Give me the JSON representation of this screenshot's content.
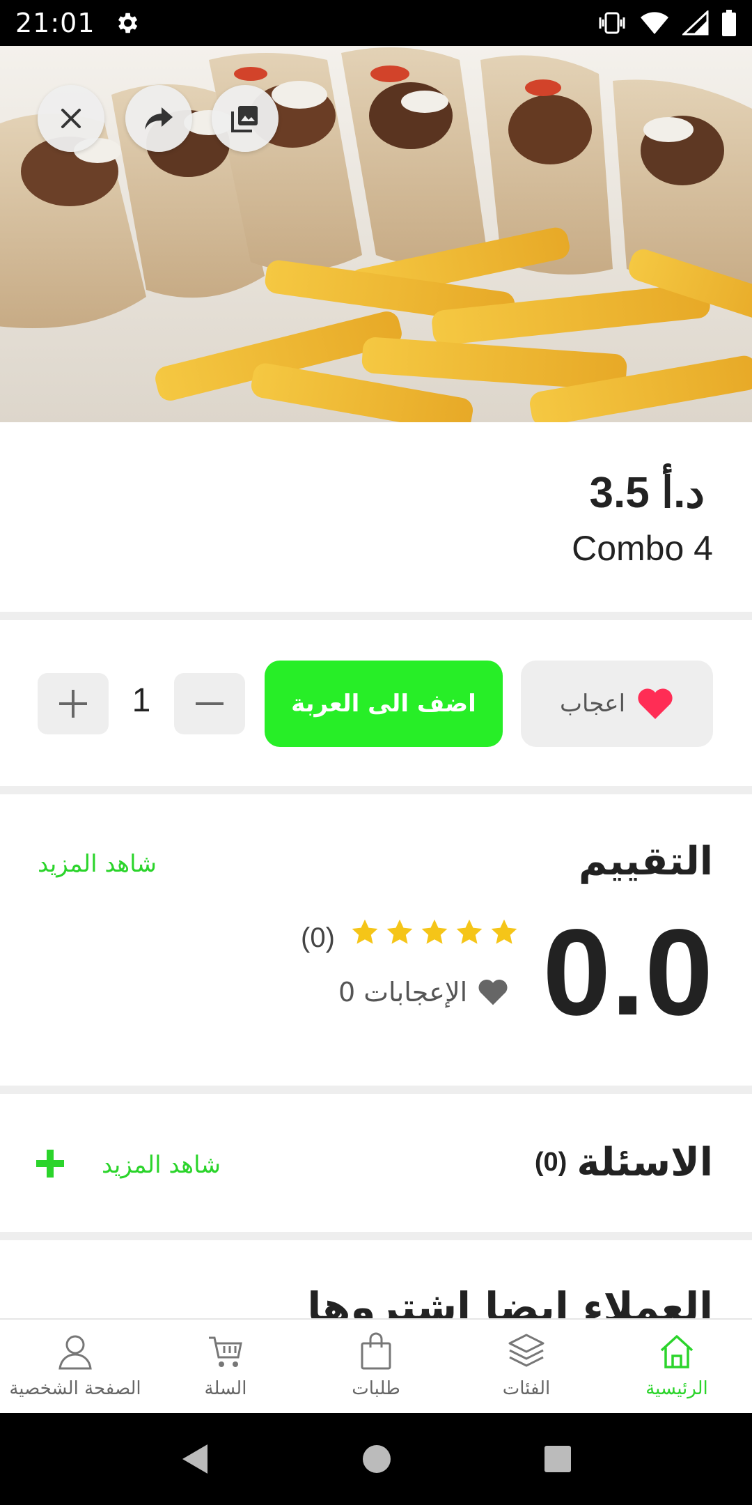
{
  "status_bar": {
    "time": "21:01"
  },
  "product": {
    "price": "د.أ 3.5",
    "name": "Combo 4"
  },
  "actions": {
    "like_label": "اعجاب",
    "add_to_cart_label": "اضف الى العربة",
    "quantity": "1"
  },
  "rating": {
    "title": "التقييم",
    "see_more": "شاهد المزيد",
    "score": "0.0",
    "stars": 0,
    "reviews_count": "(0)",
    "likes_text": "0 الإعجابات",
    "star_color": "#f5c518"
  },
  "questions": {
    "title": "الاسئلة",
    "count": "(0)",
    "see_more": "شاهد المزيد"
  },
  "bought_section": {
    "title": "العملاء ايضا اشتروها"
  },
  "bottom_nav": {
    "items": [
      {
        "label": "الصفحة الشخصية",
        "icon": "person-icon"
      },
      {
        "label": "السلة",
        "icon": "cart-icon"
      },
      {
        "label": "طلبات",
        "icon": "bag-icon"
      },
      {
        "label": "الفئات",
        "icon": "layers-icon"
      },
      {
        "label": "الرئيسية",
        "icon": "home-icon"
      }
    ],
    "active_index": 4,
    "accent_color": "#2bd42b"
  },
  "colors": {
    "accent_green": "#27ee27",
    "heart_red": "#ff2d55"
  }
}
